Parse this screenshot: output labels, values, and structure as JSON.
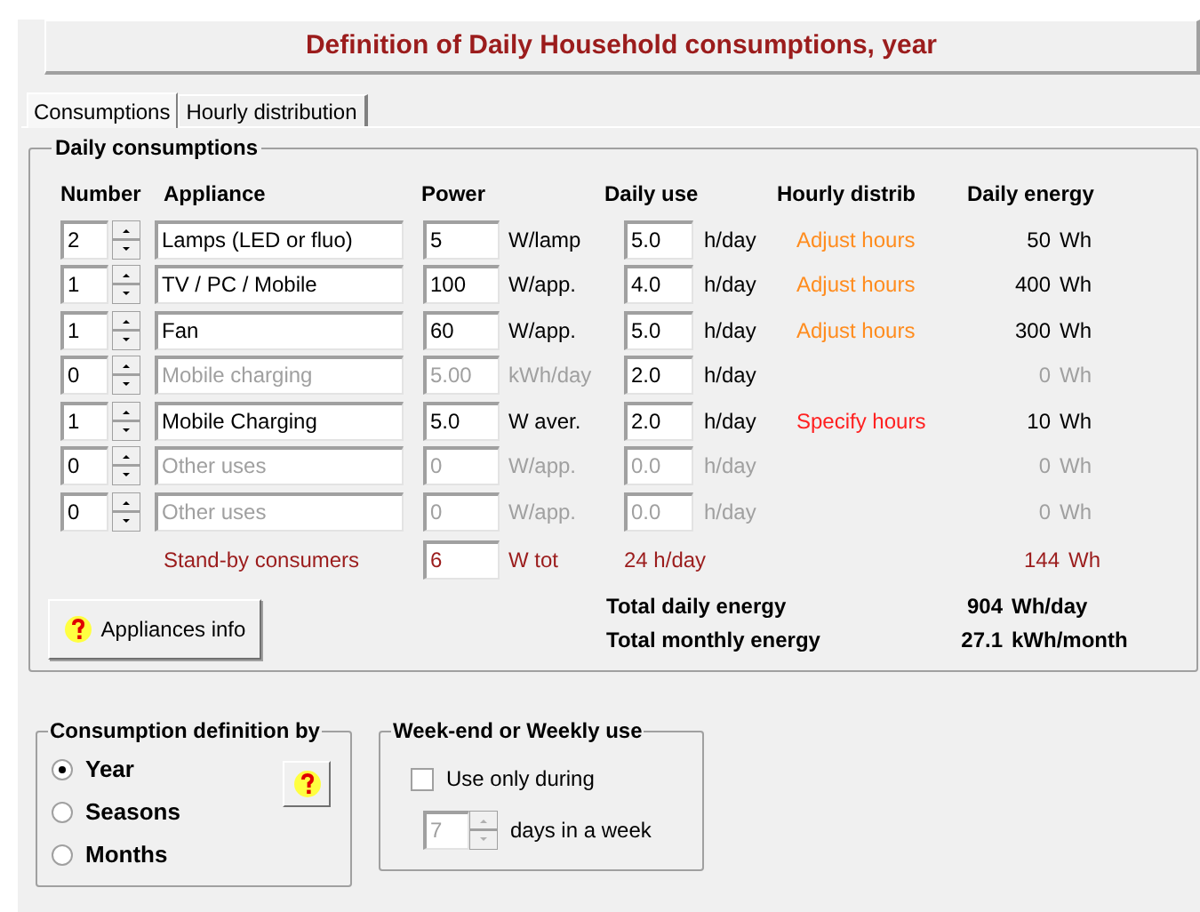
{
  "title": "Definition of Daily Household consumptions, year",
  "tabs": [
    {
      "label": "Consumptions",
      "selected": true
    },
    {
      "label": "Hourly distribution",
      "selected": false
    }
  ],
  "daily_consumptions": {
    "legend": "Daily consumptions",
    "columns": [
      "Number",
      "Appliance",
      "Power",
      "Daily use",
      "Hourly distrib",
      "Daily energy"
    ],
    "rows": [
      {
        "number": "2",
        "appliance": "Lamps (LED or fluo)",
        "power": "5",
        "power_unit": "W/lamp",
        "daily_use": "5.0",
        "use_unit": "h/day",
        "distrib": {
          "kind": "adjust",
          "label": "Adjust hours"
        },
        "energy": "50",
        "energy_unit": "Wh",
        "disabled": false
      },
      {
        "number": "1",
        "appliance": "TV / PC / Mobile",
        "power": "100",
        "power_unit": "W/app.",
        "daily_use": "4.0",
        "use_unit": "h/day",
        "distrib": {
          "kind": "adjust",
          "label": "Adjust hours"
        },
        "energy": "400",
        "energy_unit": "Wh",
        "disabled": false
      },
      {
        "number": "1",
        "appliance": "Fan",
        "power": "60",
        "power_unit": "W/app.",
        "daily_use": "5.0",
        "use_unit": "h/day",
        "distrib": {
          "kind": "adjust",
          "label": "Adjust hours"
        },
        "energy": "300",
        "energy_unit": "Wh",
        "disabled": false
      },
      {
        "number": "0",
        "appliance": "Mobile charging",
        "power": "5.00",
        "power_unit": "kWh/day",
        "daily_use": "2.0",
        "use_unit": "h/day",
        "energy": "0",
        "energy_unit": "Wh",
        "disabled": true,
        "use_disabled": false
      },
      {
        "number": "1",
        "appliance": "Mobile Charging",
        "power": "5.0",
        "power_unit": "W aver.",
        "daily_use": "2.0",
        "use_unit": "h/day",
        "distrib": {
          "kind": "specify",
          "label": "Specify hours"
        },
        "energy": "10",
        "energy_unit": "Wh",
        "disabled": false
      },
      {
        "number": "0",
        "appliance": "Other uses",
        "power": "0",
        "power_unit": "W/app.",
        "daily_use": "0.0",
        "use_unit": "h/day",
        "energy": "0",
        "energy_unit": "Wh",
        "disabled": true
      },
      {
        "number": "0",
        "appliance": "Other uses",
        "power": "0",
        "power_unit": "W/app.",
        "daily_use": "0.0",
        "use_unit": "h/day",
        "energy": "0",
        "energy_unit": "Wh",
        "disabled": true
      }
    ],
    "standby": {
      "label": "Stand-by consumers",
      "power": "6",
      "power_unit": "W tot",
      "use": "24 h/day",
      "energy": "144",
      "energy_unit": "Wh"
    },
    "info_button": "Appliances info",
    "totals": [
      {
        "label": "Total daily energy",
        "value": "904",
        "unit": "Wh/day"
      },
      {
        "label": "Total monthly energy",
        "value": "27.1",
        "unit": "kWh/month"
      }
    ]
  },
  "definition_by": {
    "legend": "Consumption definition by",
    "options": [
      {
        "label": "Year",
        "selected": true
      },
      {
        "label": "Seasons",
        "selected": false
      },
      {
        "label": "Months",
        "selected": false
      }
    ]
  },
  "weekly_use": {
    "legend": "Week-end or Weekly use",
    "checkbox": {
      "label": "Use only during",
      "checked": false
    },
    "days": "7",
    "days_label": "days in a week"
  }
}
